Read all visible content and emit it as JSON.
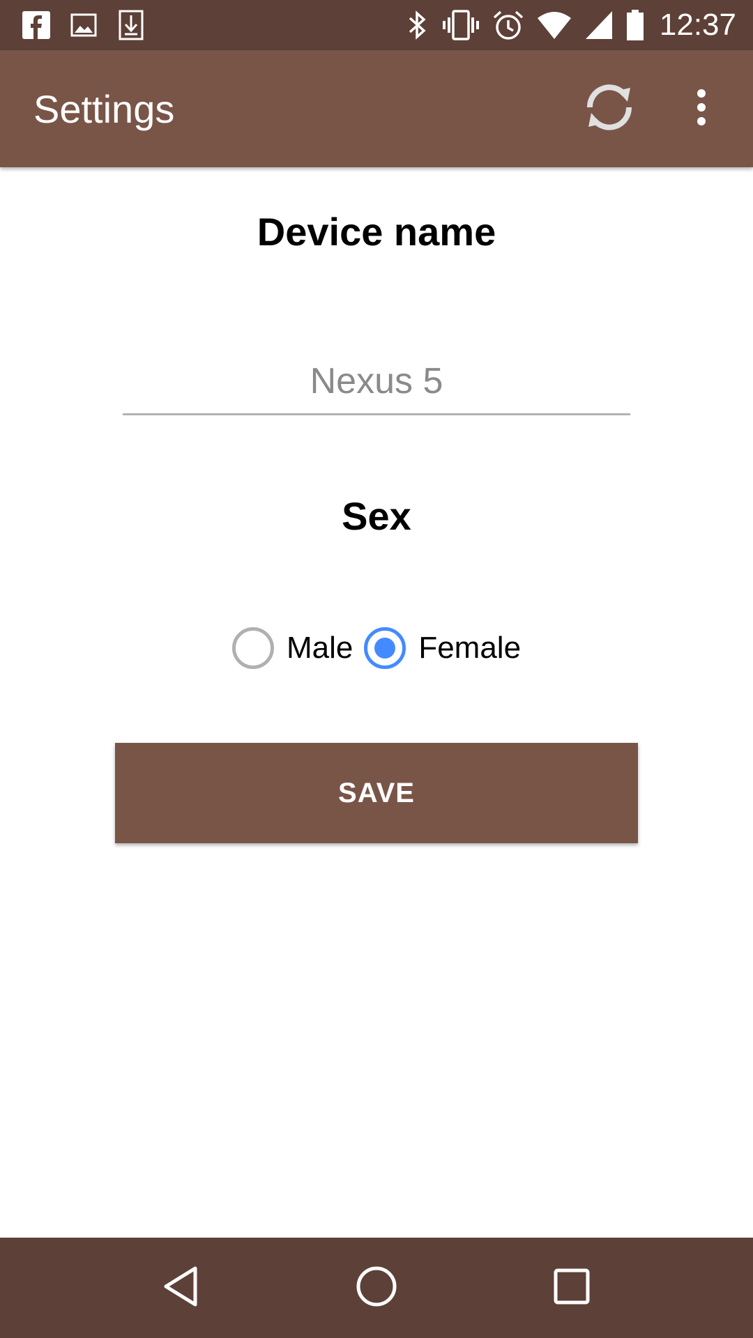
{
  "status_bar": {
    "left_icons": [
      "facebook-icon",
      "image-icon",
      "download-icon"
    ],
    "right_icons": [
      "bluetooth-icon",
      "vibrate-icon",
      "alarm-icon",
      "wifi-icon",
      "signal-icon",
      "battery-icon"
    ],
    "time": "12:37"
  },
  "toolbar": {
    "title": "Settings",
    "actions": [
      "refresh-icon",
      "more-vert-icon"
    ]
  },
  "form": {
    "device_name_heading": "Device name",
    "device_name_placeholder": "Nexus 5",
    "device_name_value": "",
    "sex_heading": "Sex",
    "sex_options": [
      {
        "label": "Male",
        "checked": false
      },
      {
        "label": "Female",
        "checked": true
      }
    ],
    "save_label": "SAVE"
  },
  "nav_bar": {
    "buttons": [
      "back-icon",
      "home-icon",
      "recents-icon"
    ]
  },
  "colors": {
    "status_bar": "#5d4037",
    "toolbar": "#795548",
    "accent": "#448aff",
    "button": "#795548"
  }
}
